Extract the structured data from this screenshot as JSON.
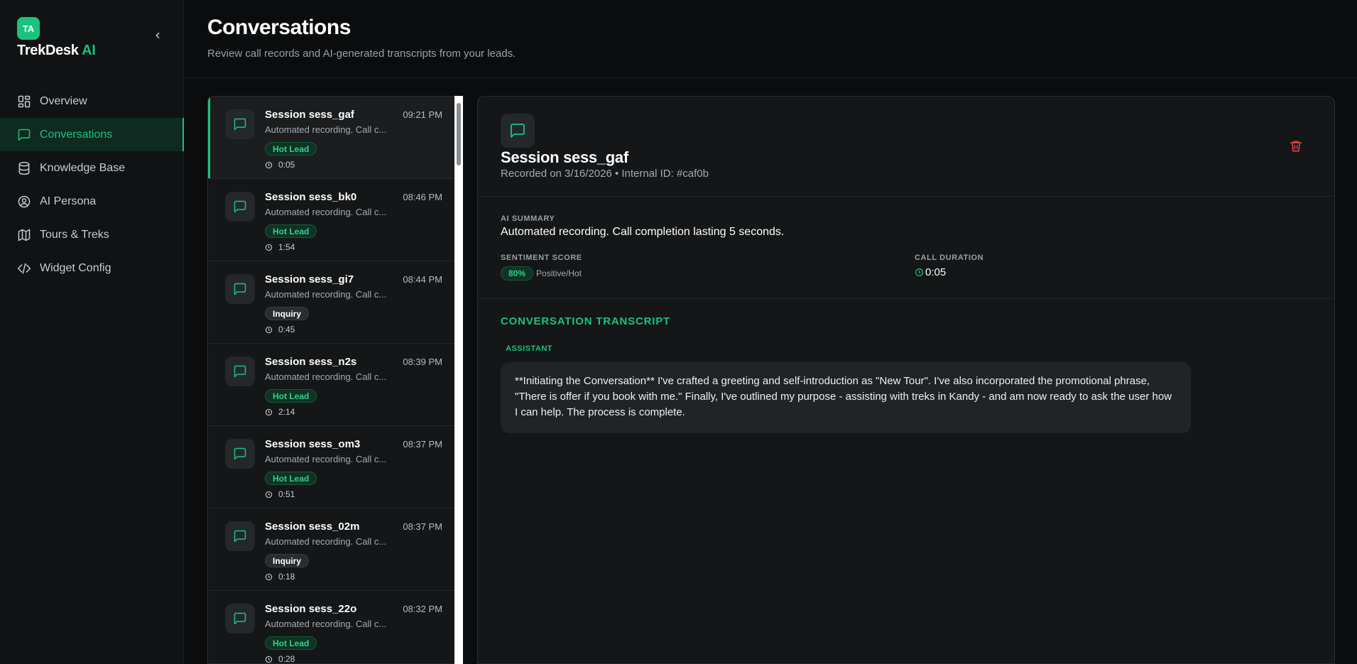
{
  "brand": {
    "badge": "TA",
    "name": "TrekDesk",
    "name_accent": "AI"
  },
  "nav": [
    {
      "label": "Overview",
      "icon": "grid-icon",
      "active": false
    },
    {
      "label": "Conversations",
      "icon": "chat-icon",
      "active": true
    },
    {
      "label": "Knowledge Base",
      "icon": "database-icon",
      "active": false
    },
    {
      "label": "AI Persona",
      "icon": "user-circle-icon",
      "active": false
    },
    {
      "label": "Tours & Treks",
      "icon": "map-icon",
      "active": false
    },
    {
      "label": "Widget Config",
      "icon": "code-icon",
      "active": false
    }
  ],
  "header": {
    "title": "Conversations",
    "subtitle": "Review call records and AI-generated transcripts from your leads."
  },
  "sessions": [
    {
      "title": "Session sess_gaf",
      "time": "09:21 PM",
      "desc": "Automated recording. Call c...",
      "badge": "Hot Lead",
      "duration": "0:05"
    },
    {
      "title": "Session sess_bk0",
      "time": "08:46 PM",
      "desc": "Automated recording. Call c...",
      "badge": "Hot Lead",
      "duration": "1:54"
    },
    {
      "title": "Session sess_gi7",
      "time": "08:44 PM",
      "desc": "Automated recording. Call c...",
      "badge": "Inquiry",
      "duration": "0:45"
    },
    {
      "title": "Session sess_n2s",
      "time": "08:39 PM",
      "desc": "Automated recording. Call c...",
      "badge": "Hot Lead",
      "duration": "2:14"
    },
    {
      "title": "Session sess_om3",
      "time": "08:37 PM",
      "desc": "Automated recording. Call c...",
      "badge": "Hot Lead",
      "duration": "0:51"
    },
    {
      "title": "Session sess_02m",
      "time": "08:37 PM",
      "desc": "Automated recording. Call c...",
      "badge": "Inquiry",
      "duration": "0:18"
    },
    {
      "title": "Session sess_22o",
      "time": "08:32 PM",
      "desc": "Automated recording. Call c...",
      "badge": "Hot Lead",
      "duration": "0:28"
    }
  ],
  "detail": {
    "title": "Session sess_gaf",
    "meta": "Recorded on 3/16/2026 • Internal ID: #caf0b",
    "summary_label": "AI SUMMARY",
    "summary_text": "Automated recording. Call completion lasting 5 seconds.",
    "sentiment_label": "SENTIMENT SCORE",
    "sentiment_value": "80%",
    "sentiment_text": "Positive/Hot",
    "duration_label": "CALL DURATION",
    "duration_value": "0:05",
    "transcript_title": "CONVERSATION TRANSCRIPT",
    "messages": [
      {
        "role": "ASSISTANT",
        "text": "**Initiating the Conversation** I've crafted a greeting and self-introduction as \"New Tour\". I've also incorporated the promotional phrase, \"There is offer if you book with me.\" Finally, I've outlined my purpose - assisting with treks in Kandy - and am now ready to ask the user how I can help. The process is complete."
      }
    ]
  },
  "colors": {
    "accent": "#19c37d",
    "danger": "#e5484d",
    "background": "#0b0c0d"
  }
}
